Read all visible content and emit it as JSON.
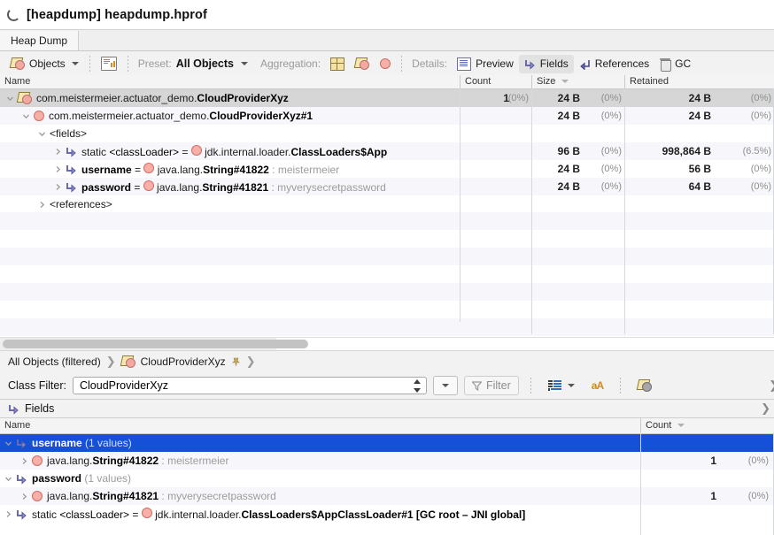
{
  "window": {
    "title": "[heapdump] heapdump.hprof",
    "spinner_icon": "spinner-icon"
  },
  "tabs": [
    {
      "label": "Heap Dump",
      "selected": true
    }
  ],
  "toolbar": {
    "objects_button": "Objects",
    "report_icon": "report-icon",
    "preset_label": "Preset:",
    "preset_value": "All Objects",
    "aggregation_label": "Aggregation:",
    "aggregation_icons": [
      "grid-icon",
      "class-icon",
      "instance-icon"
    ],
    "details_label": "Details:",
    "details_tabs": [
      {
        "label": "Preview",
        "icon": "preview-icon",
        "selected": false
      },
      {
        "label": "Fields",
        "icon": "fields-icon",
        "selected": true
      },
      {
        "label": "References",
        "icon": "references-icon",
        "selected": false
      },
      {
        "label": "GC",
        "icon": "trash-icon",
        "selected": false
      }
    ]
  },
  "tree": {
    "columns": [
      {
        "key": "name",
        "label": "Name"
      },
      {
        "key": "count",
        "label": "Count"
      },
      {
        "key": "size",
        "label": "Size",
        "sorted": true
      },
      {
        "key": "retained",
        "label": "Retained"
      }
    ],
    "rows": [
      {
        "indent": 0,
        "twisty": "down",
        "icon": "class-icon",
        "selected": true,
        "name_plain": "com.meistermeier.actuator_demo.",
        "name_bold": "CloudProviderXyz",
        "count": "1",
        "count_pct": "(0%)",
        "size": "24 B",
        "size_pct": "(0%)",
        "retained": "24 B",
        "retained_pct": "(0%)"
      },
      {
        "indent": 1,
        "twisty": "down",
        "icon": "instance-icon",
        "selected": false,
        "name_plain": "com.meistermeier.actuator_demo.",
        "name_bold": "CloudProviderXyz#1",
        "count": "",
        "count_pct": "",
        "size": "24 B",
        "size_pct": "(0%)",
        "retained": "24 B",
        "retained_pct": "(0%)"
      },
      {
        "indent": 2,
        "twisty": "down",
        "icon": "none",
        "selected": false,
        "name_plain": "<fields>",
        "name_bold": "",
        "count": "",
        "count_pct": "",
        "size": "",
        "size_pct": "",
        "retained": "",
        "retained_pct": ""
      },
      {
        "indent": 3,
        "twisty": "right",
        "icon": "fields-icon",
        "selected": false,
        "prefix": "static ",
        "field": "<classLoader>",
        "field_bold": false,
        "eq": " = ",
        "value_icon": "instance-icon",
        "value_plain": "jdk.internal.loader.",
        "value_bold": "ClassLoaders$App",
        "count": "",
        "count_pct": "",
        "size": "96 B",
        "size_pct": "(0%)",
        "retained": "998,864 B",
        "retained_pct": "(6.5%)"
      },
      {
        "indent": 3,
        "twisty": "right",
        "icon": "fields-icon",
        "selected": false,
        "prefix": "",
        "field": "username",
        "field_bold": true,
        "eq": " = ",
        "value_icon": "instance-icon",
        "value_plain": "java.lang.",
        "value_bold": "String#41822",
        "value_tail": " : meistermeier",
        "count": "",
        "count_pct": "",
        "size": "24 B",
        "size_pct": "(0%)",
        "retained": "56 B",
        "retained_pct": "(0%)"
      },
      {
        "indent": 3,
        "twisty": "right",
        "icon": "fields-icon",
        "selected": false,
        "prefix": "",
        "field": "password",
        "field_bold": true,
        "eq": " = ",
        "value_icon": "instance-icon",
        "value_plain": "java.lang.",
        "value_bold": "String#41821",
        "value_tail": " : myverysecretpassword",
        "count": "",
        "count_pct": "",
        "size": "24 B",
        "size_pct": "(0%)",
        "retained": "64 B",
        "retained_pct": "(0%)"
      },
      {
        "indent": 2,
        "twisty": "right",
        "icon": "none",
        "selected": false,
        "name_plain": "<references>",
        "name_bold": "",
        "count": "",
        "count_pct": "",
        "size": "",
        "size_pct": "",
        "retained": "",
        "retained_pct": ""
      }
    ]
  },
  "breadcrumb": {
    "root": "All Objects (filtered)",
    "sep": "❯",
    "node_icon": "class-icon",
    "node": "CloudProviderXyz",
    "pin_icon": "pin-icon"
  },
  "class_filter": {
    "label": "Class Filter:",
    "value": "CloudProviderXyz",
    "placeholder": "",
    "dropdown_icon": "chevron-down-icon",
    "filter_button": "Filter",
    "filter_icon": "funnel-icon",
    "columns_icon": "columns-icon",
    "text_icon": "font-icon",
    "objects_icon": "object-gray-icon",
    "overflow_icon": "chevron-right-icon"
  },
  "fields_panel": {
    "title": "Fields",
    "title_icon": "fields-icon",
    "overflow_icon": "chevron-right-icon",
    "columns": [
      {
        "key": "name",
        "label": "Name"
      },
      {
        "key": "count",
        "label": "Count",
        "sorted": true
      }
    ],
    "rows": [
      {
        "indent": 0,
        "twisty": "down",
        "icon": "fields-icon",
        "selected": true,
        "field": "username",
        "field_bold": true,
        "suffix": " (1 values)",
        "count": "",
        "count_pct": ""
      },
      {
        "indent": 1,
        "twisty": "right",
        "icon": "instance-icon",
        "selected": false,
        "value_plain": "java.lang.",
        "value_bold": "String#41822",
        "value_tail": " : meistermeier",
        "count": "1",
        "count_pct": "(0%)"
      },
      {
        "indent": 0,
        "twisty": "down",
        "icon": "fields-icon",
        "selected": false,
        "field": "password",
        "field_bold": true,
        "suffix": " (1 values)",
        "count": "",
        "count_pct": ""
      },
      {
        "indent": 1,
        "twisty": "right",
        "icon": "instance-icon",
        "selected": false,
        "value_plain": "java.lang.",
        "value_bold": "String#41821",
        "value_tail": " : myverysecretpassword",
        "count": "1",
        "count_pct": "(0%)"
      },
      {
        "indent": 0,
        "twisty": "right",
        "icon": "fields-icon",
        "selected": false,
        "prefix": "static ",
        "field": "<classLoader>",
        "field_bold": false,
        "eq": " = ",
        "value_icon": "instance-icon",
        "value_plain": "jdk.internal.loader.",
        "value_bold": "ClassLoaders$AppClassLoader#1 [GC root – JNI global]",
        "count": "",
        "count_pct": ""
      }
    ]
  },
  "colors": {
    "selection_blue": "#1450d8",
    "row_alt": "#f7f7fb",
    "selected_gray": "#d6d6d6",
    "toolbar_bg": "#f2f2f2",
    "dim_text": "#9c9c9c"
  }
}
